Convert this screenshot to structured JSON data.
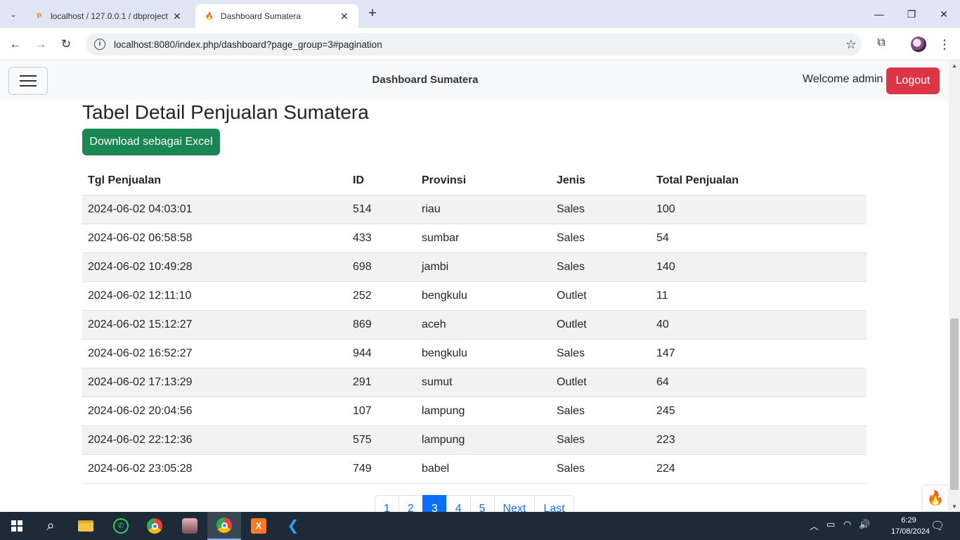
{
  "browser": {
    "tabs": [
      {
        "title": "localhost / 127.0.0.1 / dbproject",
        "favicon": "phpmyadmin-icon",
        "active": false
      },
      {
        "title": "Dashboard Sumatera",
        "favicon": "codeigniter-flame-icon",
        "active": true
      }
    ],
    "url": "localhost:8080/index.php/dashboard?page_group=3#pagination"
  },
  "navbar": {
    "brand": "Dashboard Sumatera",
    "welcome": "Welcome admin",
    "logout_label": "Logout"
  },
  "main": {
    "title": "Tabel Detail Penjualan Sumatera",
    "download_label": "Download sebagai Excel",
    "table": {
      "columns": [
        "Tgl Penjualan",
        "ID",
        "Provinsi",
        "Jenis",
        "Total Penjualan"
      ],
      "rows": [
        [
          "2024-06-02 04:03:01",
          "514",
          "riau",
          "Sales",
          "100"
        ],
        [
          "2024-06-02 06:58:58",
          "433",
          "sumbar",
          "Sales",
          "54"
        ],
        [
          "2024-06-02 10:49:28",
          "698",
          "jambi",
          "Sales",
          "140"
        ],
        [
          "2024-06-02 12:11:10",
          "252",
          "bengkulu",
          "Outlet",
          "11"
        ],
        [
          "2024-06-02 15:12:27",
          "869",
          "aceh",
          "Outlet",
          "40"
        ],
        [
          "2024-06-02 16:52:27",
          "944",
          "bengkulu",
          "Sales",
          "147"
        ],
        [
          "2024-06-02 17:13:29",
          "291",
          "sumut",
          "Outlet",
          "64"
        ],
        [
          "2024-06-02 20:04:56",
          "107",
          "lampung",
          "Sales",
          "245"
        ],
        [
          "2024-06-02 22:12:36",
          "575",
          "lampung",
          "Sales",
          "223"
        ],
        [
          "2024-06-02 23:05:28",
          "749",
          "babel",
          "Sales",
          "224"
        ]
      ]
    },
    "pagination": {
      "items": [
        "1",
        "2",
        "3",
        "4",
        "5",
        "Next",
        "Last"
      ],
      "active": "3"
    }
  },
  "taskbar": {
    "time": "6:29",
    "date": "17/08/2024"
  },
  "colors": {
    "logout": "#dc3545",
    "excel": "#198754",
    "link": "#0d6efd"
  }
}
